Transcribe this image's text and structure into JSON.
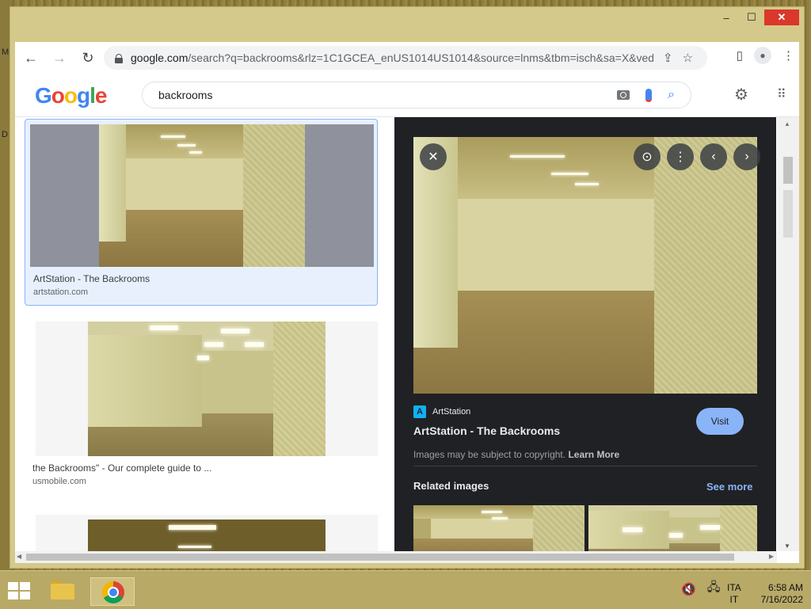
{
  "desktop": {
    "edge_letters": [
      "M",
      "D"
    ]
  },
  "window": {
    "minimize": "–",
    "maximize": "☐",
    "close": "✕"
  },
  "toolbar": {
    "back": "←",
    "forward": "→",
    "reload": "↻",
    "url_host": "google.com",
    "url_rest": "/search?q=backrooms&rlz=1C1GCEA_enUS1014US1014&source=lnms&tbm=isch&sa=X&ved...",
    "share": "⇪",
    "star": "☆",
    "side_panel": "▯",
    "menu": "⋮"
  },
  "google": {
    "logo": [
      "G",
      "o",
      "o",
      "g",
      "l",
      "e"
    ],
    "query": "backrooms",
    "search_icon": "⌕",
    "settings": "⚙",
    "apps": "⠿"
  },
  "results": [
    {
      "title": "ArtStation - The Backrooms",
      "site": "artstation.com"
    },
    {
      "title": "the Backrooms\" - Our complete guide to ...",
      "site": "usmobile.com"
    }
  ],
  "panel": {
    "close": "✕",
    "lens": "⊙",
    "more": "⋮",
    "prev": "‹",
    "next": "›",
    "source_name": "ArtStation",
    "source_logo": "A",
    "title": "ArtStation - The Backrooms",
    "visit": "Visit",
    "copyright": "Images may be subject to copyright.",
    "learn_more": "Learn More",
    "related": "Related images",
    "see_more": "See more"
  },
  "scroll": {
    "up": "▲",
    "down": "▼",
    "left": "◀",
    "right": "▶"
  },
  "taskbar": {
    "tray_volume": "🔇",
    "tray_network": "🖧",
    "lang_1": "ITA",
    "lang_2": "IT",
    "time": "6:58 AM",
    "date": "7/16/2022"
  },
  "colors": {
    "accent": "#8ab4f8",
    "panel_bg": "#202124",
    "close_red": "#d9382b"
  }
}
